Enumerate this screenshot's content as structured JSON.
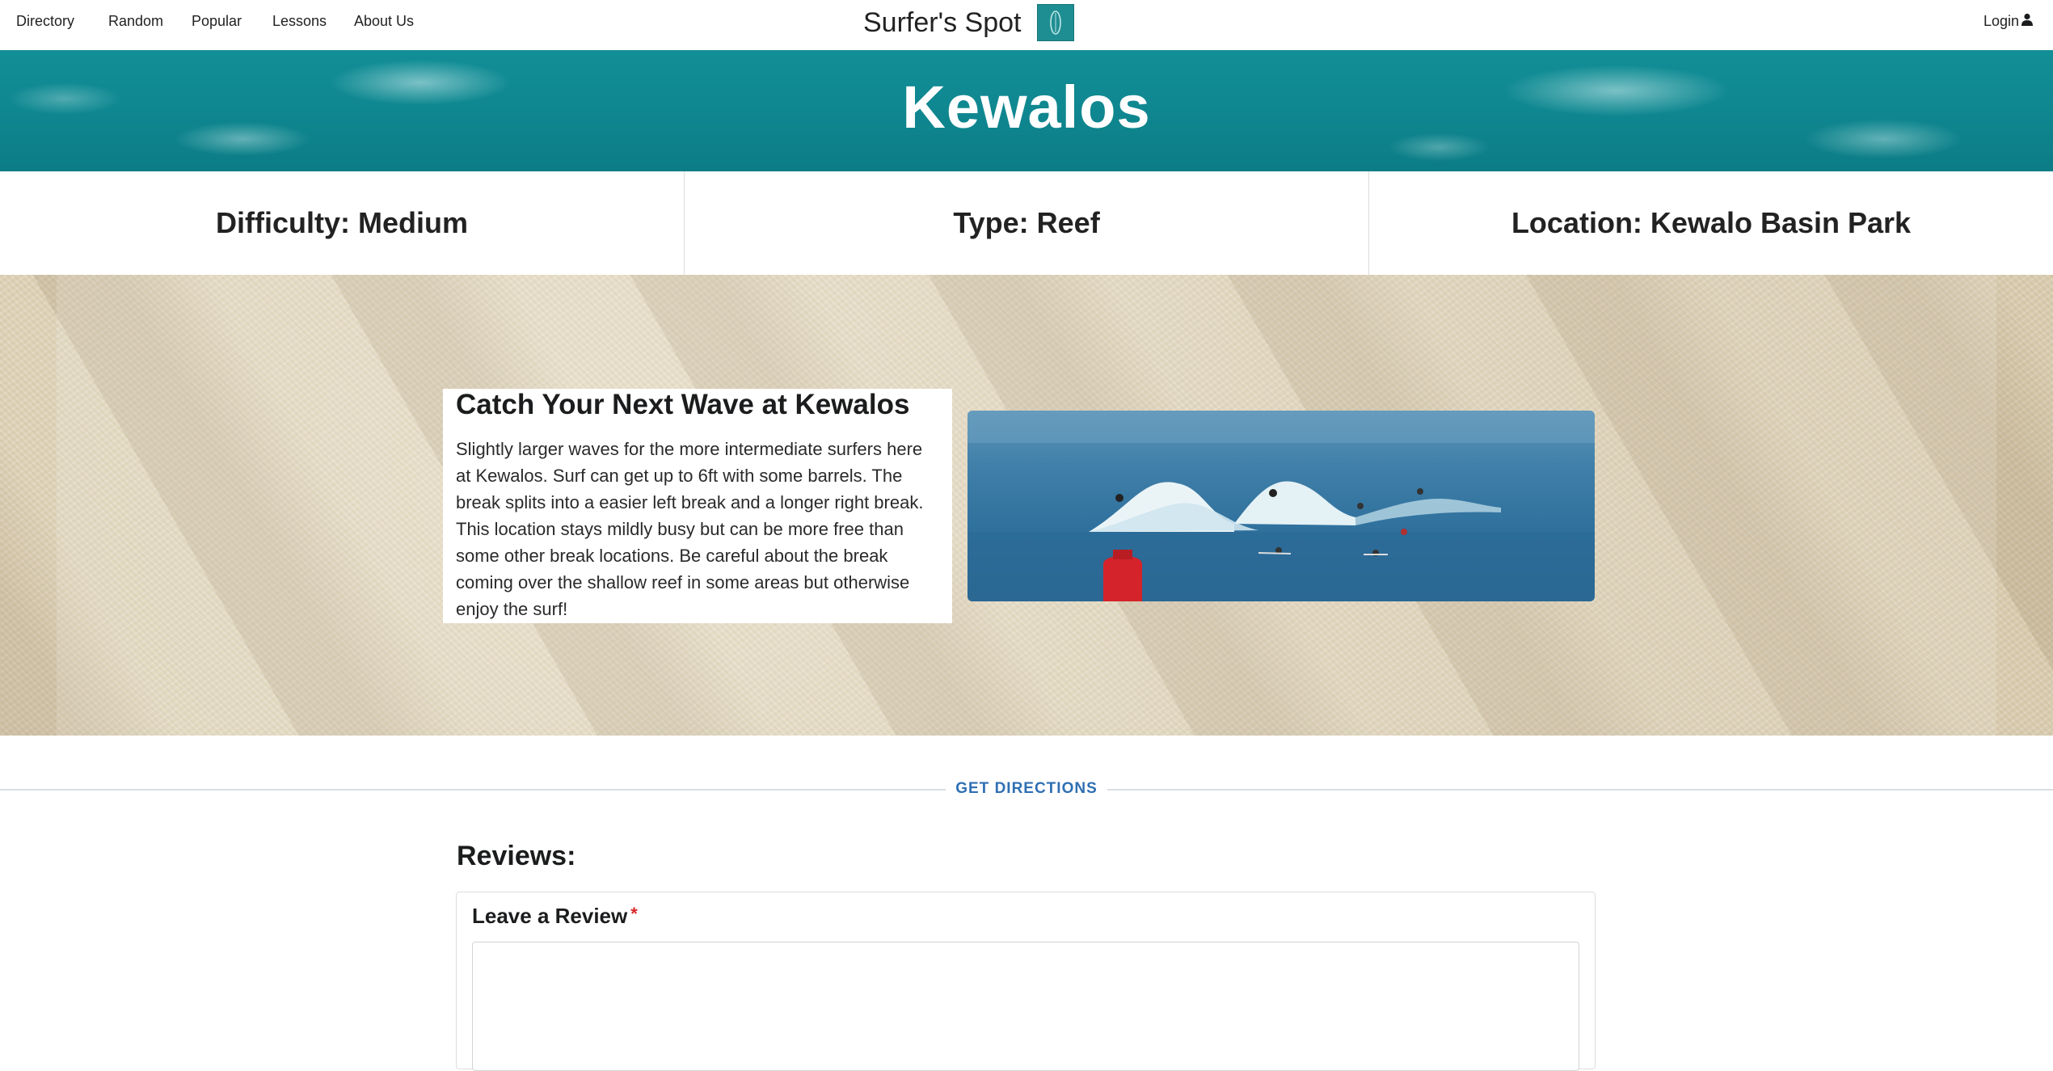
{
  "nav": {
    "links": [
      "Directory",
      "Random",
      "Popular",
      "Lessons",
      "About Us"
    ],
    "brand": "Surfer's Spot",
    "login": "Login"
  },
  "banner": {
    "title": "Kewalos"
  },
  "info": {
    "difficulty": "Difficulty: Medium",
    "type": "Type: Reef",
    "location": "Location: Kewalo Basin Park"
  },
  "feature": {
    "heading": "Catch Your Next Wave at Kewalos",
    "body": "Slightly larger waves for the more intermediate surfers here at Kewalos. Surf can get up to 6ft with some barrels. The break splits into a easier left break and a longer right break. This location stays mildly busy but can be more free than some other break locations. Be careful about the break coming over the shallow reef in some areas but otherwise enjoy the surf!"
  },
  "directions": {
    "label": "GET DIRECTIONS"
  },
  "reviews": {
    "title": "Reviews:",
    "leave_label": "Leave a Review",
    "required_mark": "*",
    "textarea_value": ""
  },
  "icons": {
    "logo": "surfboard-logo-icon",
    "login": "user-icon"
  },
  "colors": {
    "banner": "#128e96",
    "logo_bg": "#1f8e92",
    "link_blue": "#2f6fb3",
    "required_red": "#db2828"
  }
}
